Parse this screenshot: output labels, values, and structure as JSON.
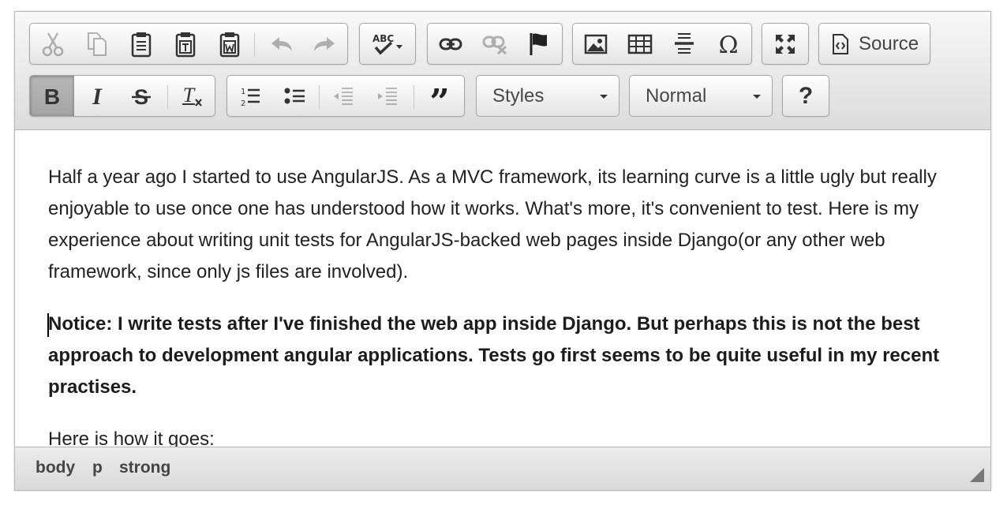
{
  "toolbar": {
    "row1": {
      "clipboard": [
        "cut-icon",
        "copy-icon",
        "paste-icon",
        "paste-text-icon",
        "paste-word-icon"
      ],
      "history": [
        "undo-icon",
        "redo-icon"
      ],
      "spellcheck_icon": "spellcheck-abc-icon",
      "links": [
        "link-icon",
        "unlink-icon",
        "anchor-flag-icon"
      ],
      "insert": [
        "image-icon",
        "table-icon",
        "horizontal-line-icon",
        "special-char-omega-icon"
      ],
      "maximize_icon": "maximize-icon",
      "source_label": "Source"
    },
    "row2": {
      "basicstyles": [
        "bold-icon",
        "italic-icon",
        "strike-icon",
        "remove-format-icon"
      ],
      "lists": [
        "numbered-list-icon",
        "bulleted-list-icon",
        "outdent-icon",
        "indent-icon",
        "blockquote-icon"
      ],
      "styles_label": "Styles",
      "format_label": "Normal",
      "help_label": "?"
    }
  },
  "content": {
    "para1": "Half a year ago I started to use AngularJS. As a MVC framework, its learning curve is a little ugly but really enjoyable to use once one has understood how it works. What's more, it's convenient to test. Here is my experience about writing unit tests for AngularJS-backed web pages inside Django(or any other web framework, since only js files are involved).",
    "para2": "Notice: I write tests after I've finished the web app inside Django. But perhaps this is not the best approach to development angular applications. Tests go first seems to be quite useful in my recent practises.",
    "para3": "Here is how it goes:"
  },
  "statusbar": {
    "path": [
      "body",
      "p",
      "strong"
    ]
  },
  "colors": {
    "toolbar_bg": "#e4e4e4",
    "active_button": "#a8a8a8",
    "border": "#a6a6a6",
    "text": "#222222"
  }
}
